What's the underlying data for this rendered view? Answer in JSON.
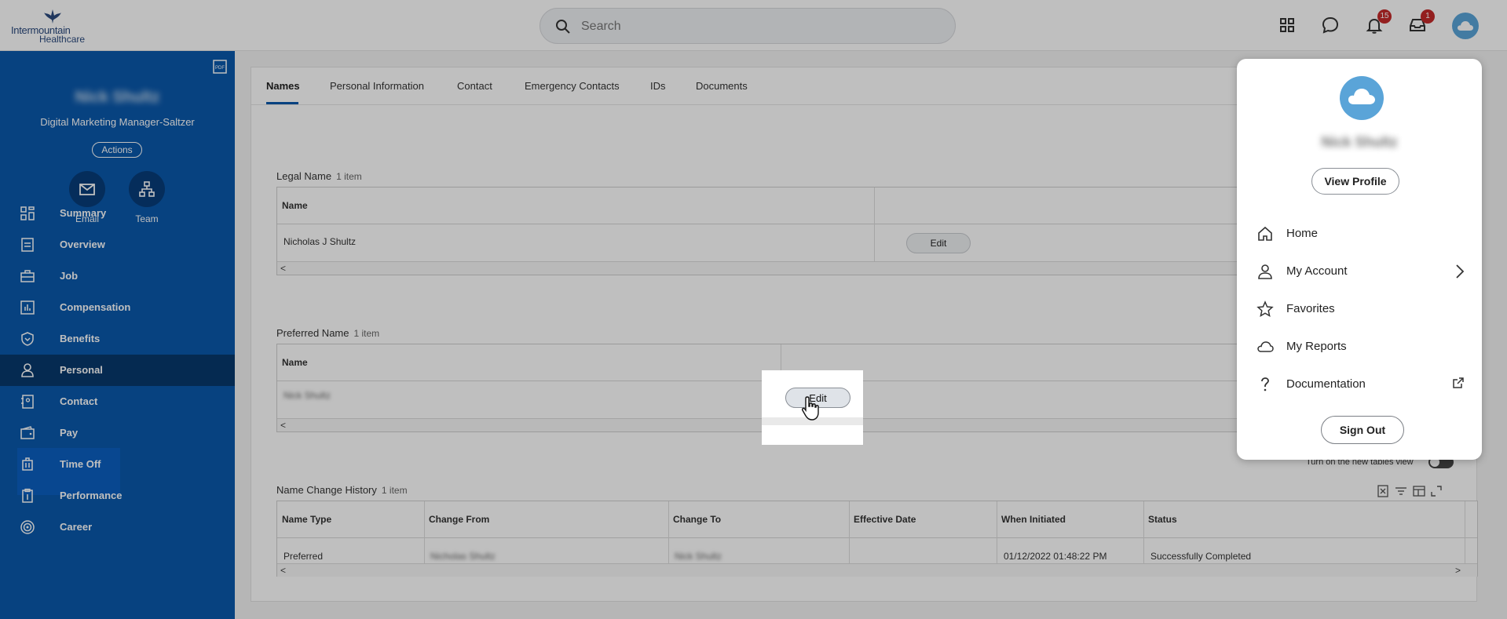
{
  "header": {
    "logo_brand": "Intermountain",
    "logo_sub": "Healthcare",
    "search_placeholder": "Search",
    "notifications_count": "15",
    "inbox_count": "1"
  },
  "sidebar": {
    "name": "Nick Shultz",
    "title": "Digital Marketing Manager-Saltzer",
    "actions_label": "Actions",
    "email_label": "Email",
    "team_label": "Team",
    "nav": [
      {
        "label": "Summary",
        "icon": "grid-icon"
      },
      {
        "label": "Overview",
        "icon": "document-icon"
      },
      {
        "label": "Job",
        "icon": "briefcase-icon"
      },
      {
        "label": "Compensation",
        "icon": "chart-icon"
      },
      {
        "label": "Benefits",
        "icon": "shield-icon"
      },
      {
        "label": "Personal",
        "icon": "person-icon"
      },
      {
        "label": "Contact",
        "icon": "contact-book-icon"
      },
      {
        "label": "Pay",
        "icon": "wallet-icon"
      },
      {
        "label": "Time Off",
        "icon": "luggage-icon"
      },
      {
        "label": "Performance",
        "icon": "clipboard-icon"
      },
      {
        "label": "Career",
        "icon": "target-icon"
      }
    ]
  },
  "tabs": [
    "Names",
    "Personal Information",
    "Contact",
    "Emergency Contacts",
    "IDs",
    "Documents"
  ],
  "legal_name": {
    "title": "Legal Name",
    "count": "1 item",
    "col_name": "Name",
    "value": "Nicholas J Shultz",
    "edit_label": "Edit"
  },
  "preferred_name": {
    "title": "Preferred Name",
    "count": "1 item",
    "col_name": "Name",
    "value": "Nick Shultz",
    "edit_label": "Edit"
  },
  "history": {
    "title": "Name Change History",
    "count": "1 item",
    "columns": [
      "Name Type",
      "Change From",
      "Change To",
      "Effective Date",
      "When Initiated",
      "Status"
    ],
    "row": {
      "name_type": "Preferred",
      "change_from": "Nicholas Shultz",
      "change_to": "Nick Shultz",
      "effective_date": "",
      "when_initiated": "01/12/2022 01:48:22 PM",
      "status": "Successfully Completed"
    },
    "toggle_label": "Turn on the new tables view"
  },
  "dropdown": {
    "name": "Nick Shultz",
    "view_profile": "View Profile",
    "items": [
      {
        "label": "Home",
        "icon": "home-icon"
      },
      {
        "label": "My Account",
        "icon": "person-icon"
      },
      {
        "label": "Favorites",
        "icon": "star-icon"
      },
      {
        "label": "My Reports",
        "icon": "cloud-icon"
      },
      {
        "label": "Documentation",
        "icon": "question-icon"
      }
    ],
    "sign_out": "Sign Out"
  },
  "colors": {
    "sidebar_bg": "#0a58ab",
    "sidebar_active": "#07386d",
    "badge": "#c42a2a",
    "accent": "#0a58ab"
  }
}
